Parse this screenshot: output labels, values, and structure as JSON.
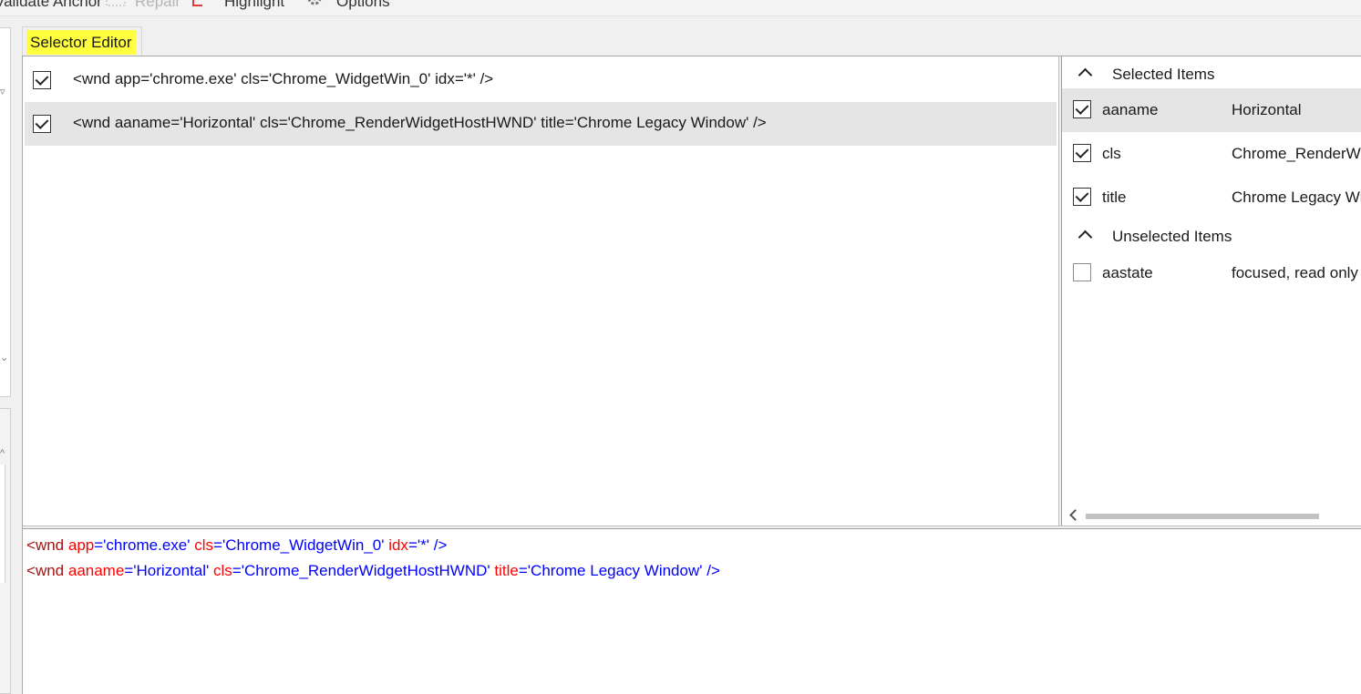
{
  "toolbar": {
    "items": [
      "Validate Anchor",
      "Repair",
      "Highlight",
      "Options"
    ]
  },
  "tab": {
    "label": "Selector Editor"
  },
  "selectors": [
    {
      "checked": true,
      "text": "<wnd app='chrome.exe' cls='Chrome_WidgetWin_0' idx='*' />"
    },
    {
      "checked": true,
      "text": "<wnd aaname='Horizontal' cls='Chrome_RenderWidgetHostHWND' title='Chrome Legacy Window' />"
    }
  ],
  "attributes": {
    "selected_title": "Selected Items",
    "unselected_title": "Unselected Items",
    "selected": [
      {
        "name": "aaname",
        "value": "Horizontal",
        "checked": true
      },
      {
        "name": "cls",
        "value": "Chrome_RenderWidgetHostHWND",
        "checked": true
      },
      {
        "name": "title",
        "value": "Chrome Legacy Window",
        "checked": true
      }
    ],
    "unselected": [
      {
        "name": "aastate",
        "value": "focused, read only",
        "checked": false
      }
    ]
  },
  "xml_lines": [
    {
      "tag": "wnd",
      "attrs": [
        {
          "name": "app",
          "value": "chrome.exe"
        },
        {
          "name": "cls",
          "value": "Chrome_WidgetWin_0"
        },
        {
          "name": "idx",
          "value": "*"
        }
      ]
    },
    {
      "tag": "wnd",
      "attrs": [
        {
          "name": "aaname",
          "value": "Horizontal"
        },
        {
          "name": "cls",
          "value": "Chrome_RenderWidgetHostHWND"
        },
        {
          "name": "title",
          "value": "Chrome Legacy Window"
        }
      ]
    }
  ],
  "colors": {
    "highlight": "#ffff40",
    "xml_tag": "#a31515",
    "xml_attr": "#ff0000",
    "xml_value": "#0000ff"
  }
}
